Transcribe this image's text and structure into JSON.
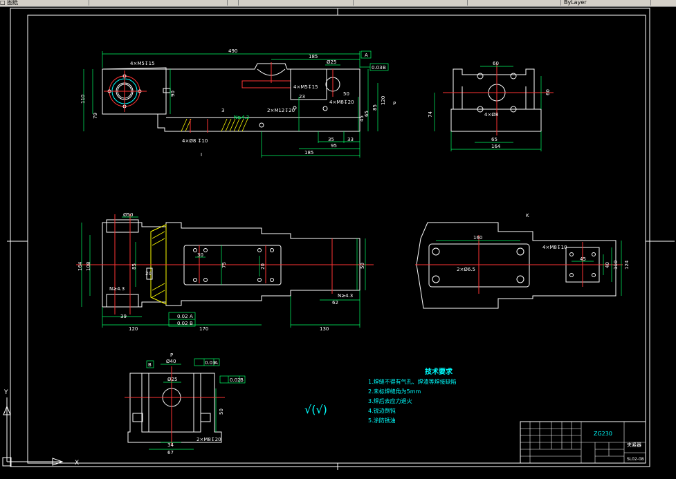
{
  "toolbar": {
    "items": [
      "□ 图纸",
      "",
      "",
      "",
      "",
      "",
      "",
      "ByLayer"
    ]
  },
  "drawing": {
    "view1": {
      "overall": "490",
      "d185": "185",
      "d025": "Ø25",
      "label_a": "A",
      "tol": "0.03",
      "tol_ref": "B",
      "hole_note": "4×M5↧15",
      "h110": "110",
      "h90": "90",
      "h79": "79",
      "d23": "23",
      "h50": "50",
      "note_m8": "4×M8↧20",
      "note_m12": "2×M12↧20",
      "note_m5b": "4×M5↧15",
      "d85": "85",
      "d120": "120",
      "d65": "65",
      "d45": "45",
      "d35": "35",
      "d33": "33",
      "d95": "95",
      "d185b": "185",
      "weld": "3",
      "weld2": "N≥4.3",
      "note_bottom": "4×Ø8 ↧10",
      "label_p": "P",
      "label_i": "I"
    },
    "view2": {
      "d60": "60",
      "h60": "60",
      "h74": "74",
      "hole": "4×Ø8",
      "d65": "65",
      "d164": "164"
    },
    "view3": {
      "d50": "Ø50",
      "d30": "30",
      "d75": "75",
      "d164": "164",
      "d108": "108",
      "d85": "85",
      "d20": "20",
      "d50b": "50",
      "d62": "62",
      "d120": "120",
      "d170": "170",
      "d130": "130",
      "d39": "39",
      "tol1": "0.02",
      "tol1_ref": "A",
      "tol2": "0.02",
      "tol2_ref": "B",
      "weld": "N≥4.3",
      "weld2": "N≥4.3",
      "d20b": "20"
    },
    "view4": {
      "d160": "160",
      "d45": "45",
      "d40": "40",
      "d110": "110",
      "d124": "124",
      "note": "2×Ø6.5",
      "label_k": "K",
      "note2": "4×M8↧10"
    },
    "view5": {
      "label_p": "P",
      "label_b": "B",
      "d40": "Ø40",
      "tol": "0.03",
      "tol_ref": "A",
      "d25": "Ø25",
      "tol2": "0.02",
      "tol2_ref": "B",
      "h50": "50",
      "note": "2×M8↧20",
      "d34": "34",
      "d67": "67"
    },
    "roughness": "√(√)",
    "tech": {
      "title": "技术要求",
      "items": [
        "1.焊缝不得有气孔、焊渣等焊接缺陷",
        "2.未标焊缝角为5mm",
        "3.焊后去应力退火",
        "4.锐边倒钝",
        "5.涂防锈油"
      ]
    },
    "titleblock": {
      "code": "ZG230",
      "name": "夹紧器",
      "num": "SL02-08"
    },
    "ucs": {
      "x": "X",
      "y": "Y"
    }
  }
}
